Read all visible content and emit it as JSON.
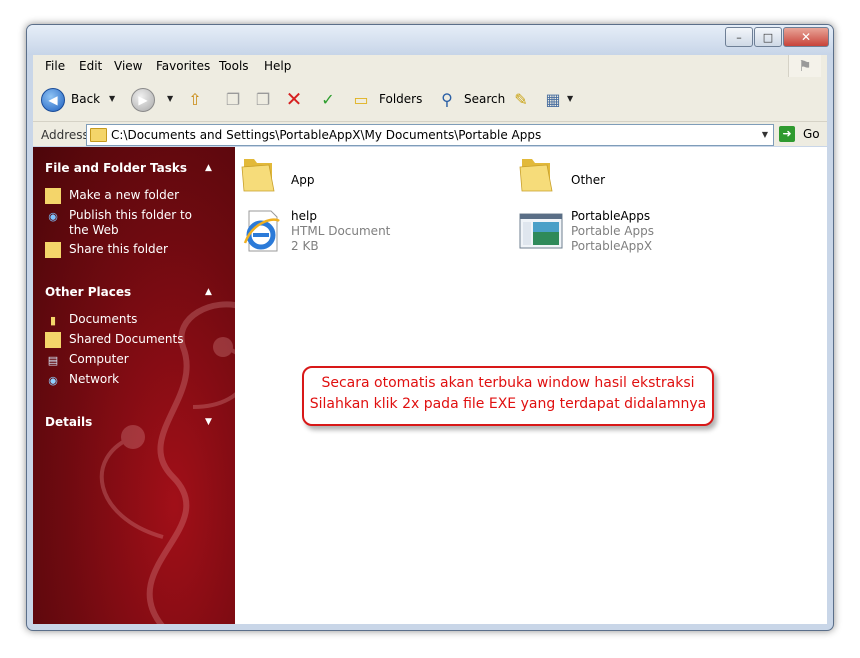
{
  "menu": [
    "File",
    "Edit",
    "View",
    "Favorites",
    "Tools",
    "Help"
  ],
  "toolbar": {
    "back_label": "Back",
    "folders_label": "Folders",
    "search_label": "Search"
  },
  "address": {
    "label": "Address",
    "path": "C:\\Documents and Settings\\PortableAppX\\My Documents\\Portable Apps",
    "go_label": "Go"
  },
  "tasks": {
    "file_folder_title": "File and Folder Tasks",
    "file_folder_items": [
      "Make a new folder",
      "Publish this folder to the Web",
      "Share this folder"
    ],
    "other_places_title": "Other Places",
    "other_places_items": [
      "Documents",
      "Shared Documents",
      "Computer",
      "Network"
    ],
    "details_title": "Details"
  },
  "files": [
    {
      "name": "App",
      "type": "folder"
    },
    {
      "name": "Other",
      "type": "folder"
    },
    {
      "name": "help",
      "type": "html",
      "subtitle": "HTML Document",
      "size": "2 KB"
    },
    {
      "name": "PortableApps",
      "type": "app",
      "subtitle": "Portable Apps",
      "company": "PortableAppX"
    }
  ],
  "annotation": {
    "line1": "Secara otomatis akan terbuka window hasil ekstraksi",
    "line2": "Silahkan klik 2x pada file EXE yang terdapat didalamnya"
  },
  "colors": {
    "pane_red": "#6e0a10",
    "callout_red": "#e01010",
    "folder_yellow": "#f4d56a"
  }
}
